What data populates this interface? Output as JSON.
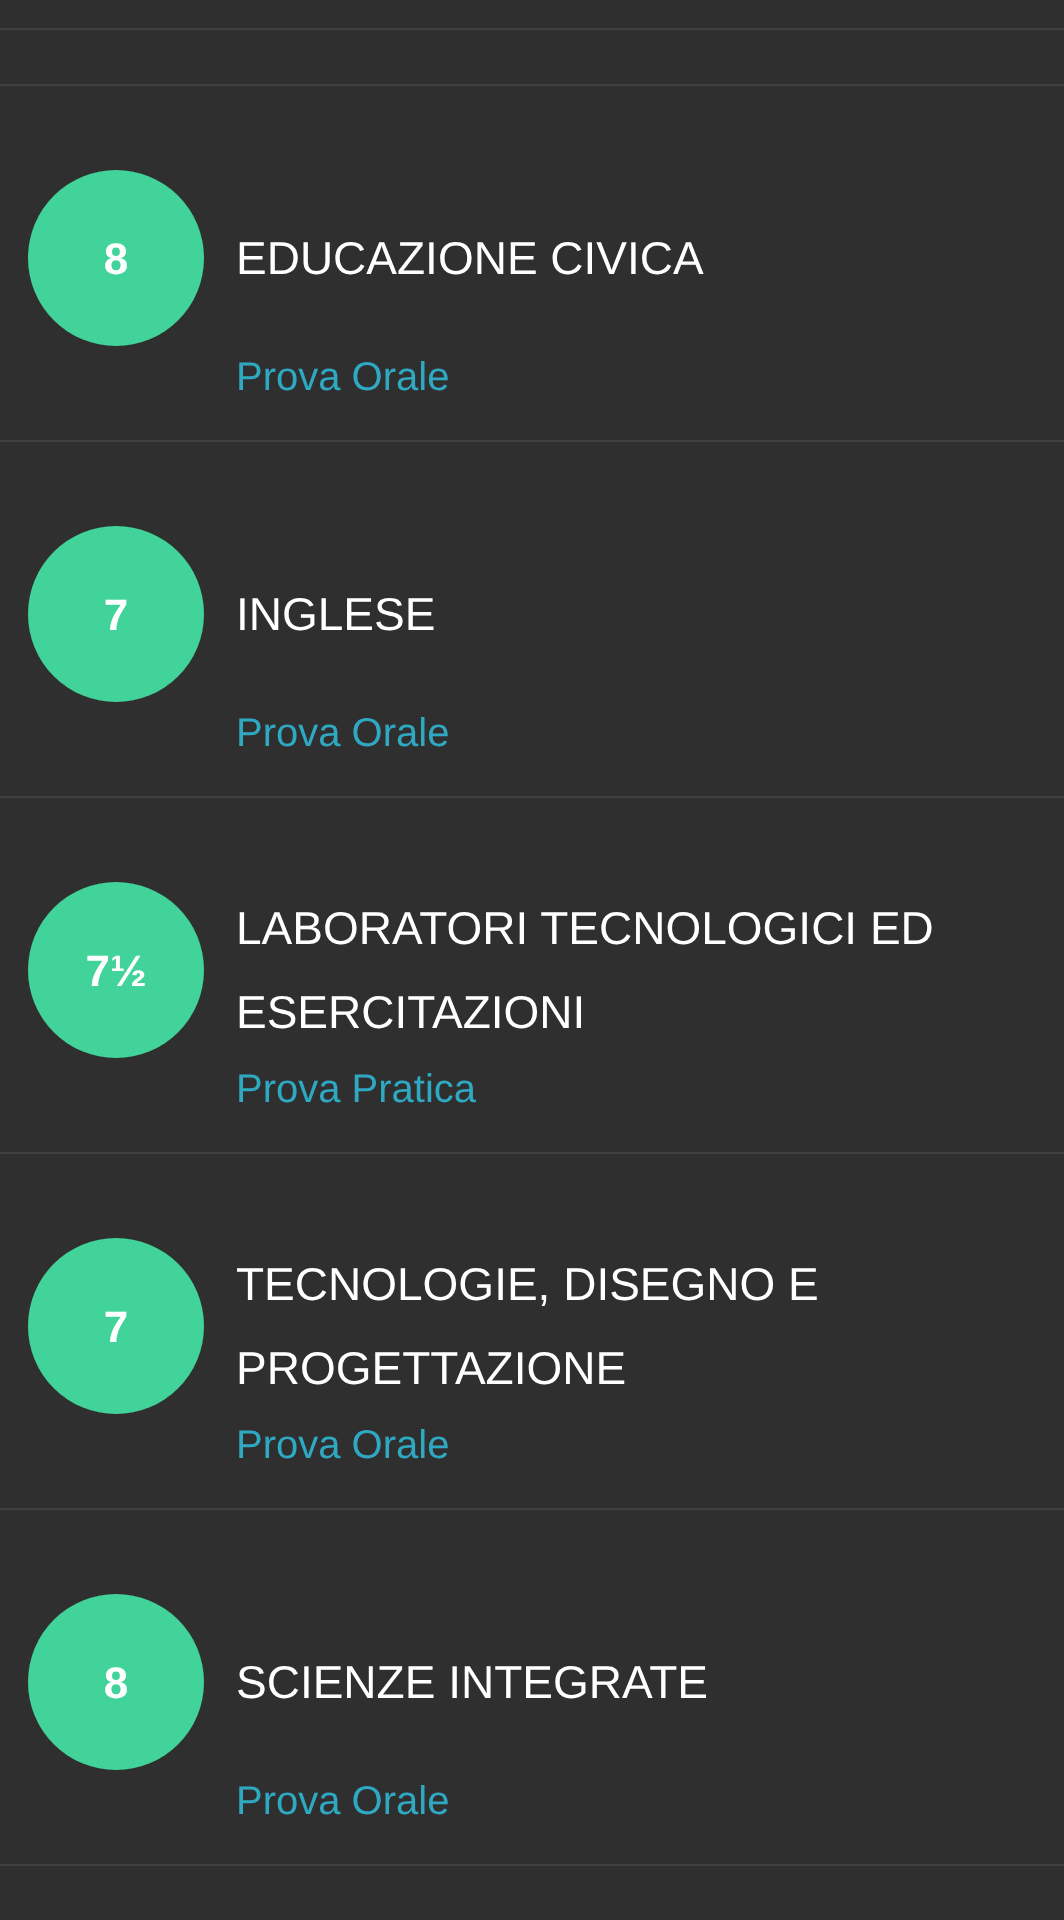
{
  "grades": [
    {
      "grade": "8",
      "subject": "EDUCAZIONE CIVICA",
      "test_type": "Prova Orale"
    },
    {
      "grade": "7",
      "subject": "INGLESE",
      "test_type": "Prova Orale"
    },
    {
      "grade": "7½",
      "subject": "LABORATORI TECNOLOGICI ED ESERCITAZIONI",
      "test_type": "Prova Pratica"
    },
    {
      "grade": "7",
      "subject": "TECNOLOGIE, DISEGNO E PROGETTAZIONE",
      "test_type": "Prova Orale"
    },
    {
      "grade": "8",
      "subject": "SCIENZE INTEGRATE",
      "test_type": "Prova Orale"
    }
  ]
}
